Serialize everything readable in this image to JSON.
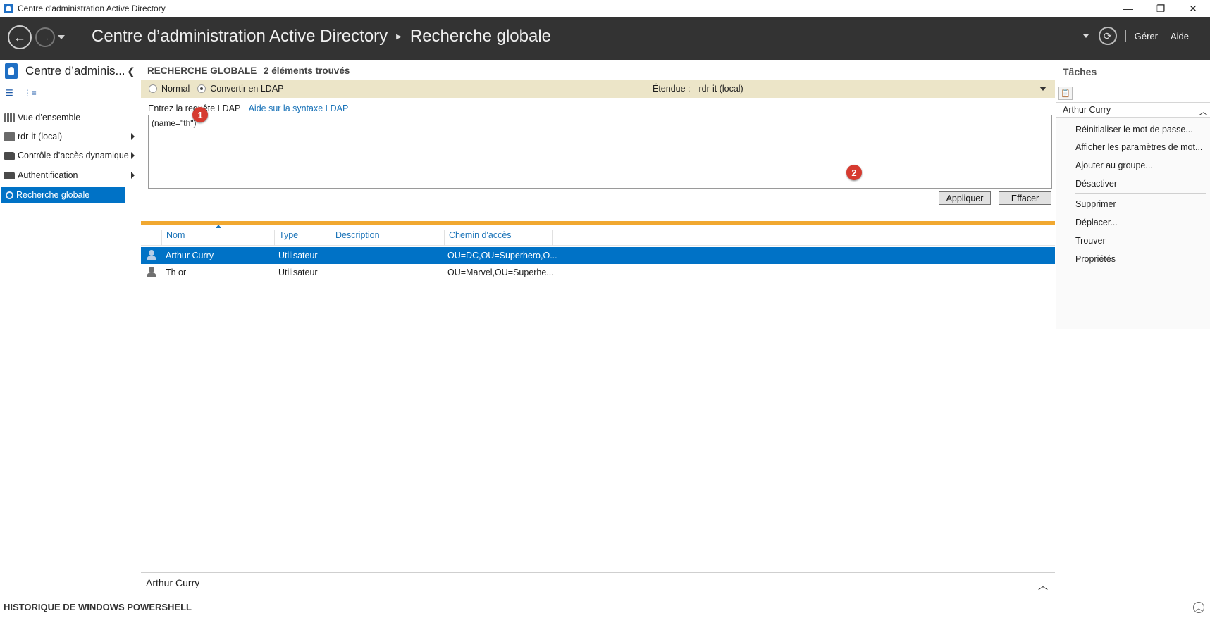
{
  "window": {
    "title": "Centre d'administration Active Directory",
    "minimize_glyph": "—",
    "restore_glyph": "❐",
    "close_glyph": "✕"
  },
  "header": {
    "breadcrumb_root": "Centre d’administration Active Directory",
    "breadcrumb_current": "Recherche globale",
    "manage_label": "Gérer",
    "help_label": "Aide"
  },
  "sidebar": {
    "title": "Centre d’adminis...",
    "items": [
      {
        "label": "Vue d’ensemble",
        "icon": "overview-grid-icon"
      },
      {
        "label": "rdr-it (local)",
        "icon": "domain-server-icon"
      },
      {
        "label": "Contrôle d’accès dynamique",
        "icon": "folder-icon"
      },
      {
        "label": "Authentification",
        "icon": "folder-icon"
      },
      {
        "label": "Recherche globale",
        "icon": "search-icon",
        "selected": true
      }
    ]
  },
  "search": {
    "title": "RECHERCHE GLOBALE",
    "count_label": "2 éléments trouvés",
    "radio_normal": "Normal",
    "radio_ldap": "Convertir en LDAP",
    "scope_label": "Étendue :",
    "scope_value": "rdr-it (local)",
    "query_label": "Entrez la requête LDAP",
    "query_help_link": "Aide sur la syntaxe LDAP",
    "query_value": "(name=\"th\")",
    "apply_label": "Appliquer",
    "clear_label": "Effacer",
    "badge1": "1",
    "badge2": "2"
  },
  "results": {
    "columns": [
      "Nom",
      "Type",
      "Description",
      "Chemin d'accès"
    ],
    "rows": [
      {
        "name": "Arthur Curry",
        "type": "Utilisateur",
        "description": "",
        "path": "OU=DC,OU=Superhero,O...",
        "selected": true
      },
      {
        "name": "Th or",
        "type": "Utilisateur",
        "description": "",
        "path": "OU=Marvel,OU=Superhe..."
      }
    ]
  },
  "detail": {
    "label": "Arthur Curry"
  },
  "tasks": {
    "title": "Tâches",
    "section": "Arthur Curry",
    "items": [
      "Réinitialiser le mot de passe...",
      "Afficher les paramètres de mot...",
      "Ajouter au groupe...",
      "Désactiver",
      "Supprimer",
      "Déplacer...",
      "Trouver",
      "Propriétés"
    ]
  },
  "powershell": {
    "label": "HISTORIQUE DE WINDOWS POWERSHELL"
  },
  "colors": {
    "accent_selected": "#0072c6",
    "header_bg": "#333333",
    "option_bar": "#ece5c8",
    "grid_divider": "#f1a830",
    "callout_badge": "#d63a2f"
  }
}
